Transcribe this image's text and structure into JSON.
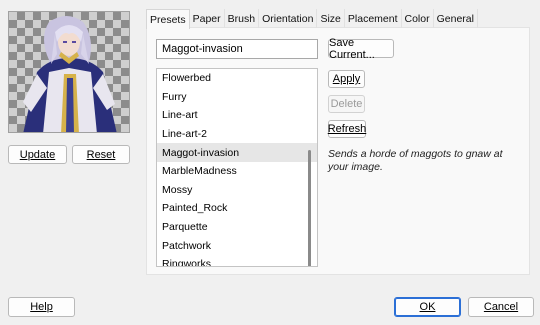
{
  "preview": {
    "update_label": "Update",
    "reset_label": "Reset"
  },
  "tabs": [
    "Presets",
    "Paper",
    "Brush",
    "Orientation",
    "Size",
    "Placement",
    "Color",
    "General"
  ],
  "presets": {
    "name_value": "Maggot-invasion",
    "save_current_label": "Save Current...",
    "apply_label": "Apply",
    "delete_label": "Delete",
    "refresh_label": "Refresh",
    "description": "Sends a horde of maggots to gnaw at your image.",
    "items": [
      "Flowerbed",
      "Furry",
      "Line-art",
      "Line-art-2",
      "Maggot-invasion",
      "MarbleMadness",
      "Mossy",
      "Painted_Rock",
      "Parquette",
      "Patchwork",
      "Ringworks"
    ],
    "selected": "Maggot-invasion"
  },
  "footer": {
    "help_label": "Help",
    "ok_label": "OK",
    "cancel_label": "Cancel"
  }
}
